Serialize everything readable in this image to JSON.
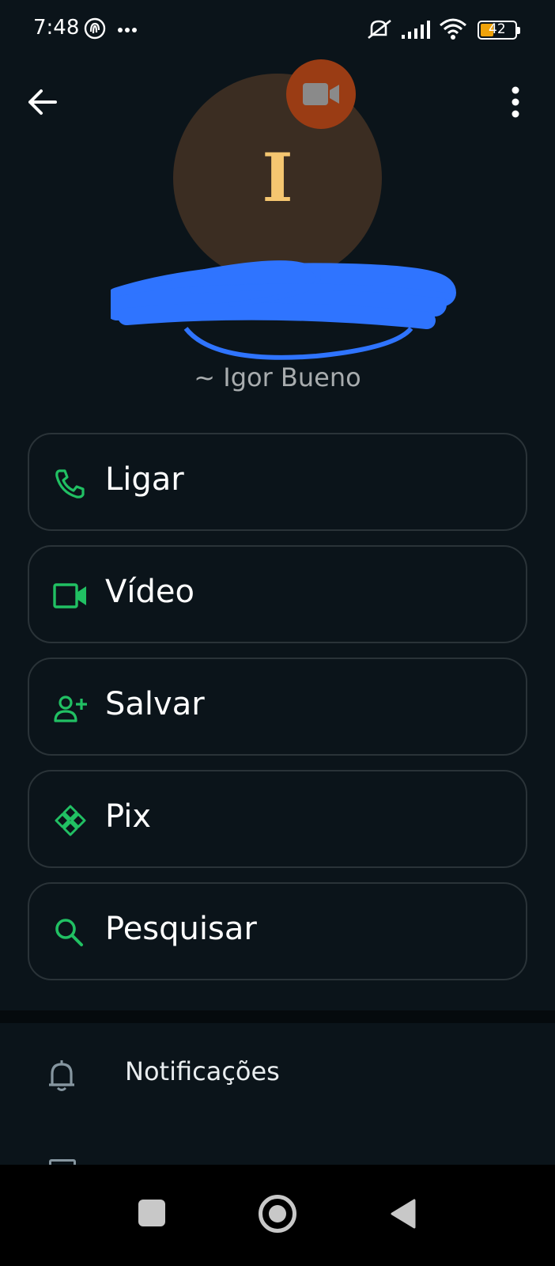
{
  "status_bar": {
    "time": "7:48",
    "battery_level": "42",
    "icons": [
      "fingerprint-icon",
      "more-dots-icon",
      "silent-icon",
      "signal-icon",
      "wifi-icon",
      "battery-icon"
    ]
  },
  "header": {
    "back_icon": "arrow-left-icon",
    "menu_icon": "more-vertical-icon"
  },
  "contact": {
    "avatar_letter": "I",
    "subtitle": "~ Igor Bueno",
    "avatar_bg": "#3b2d22",
    "avatar_fg": "#f5c670",
    "video_badge_bg": "#9a3c14",
    "name_redacted": true
  },
  "actions": [
    {
      "label": "Ligar",
      "icon": "phone-icon"
    },
    {
      "label": "Vídeo",
      "icon": "video-icon"
    },
    {
      "label": "Salvar",
      "icon": "add-person-icon"
    },
    {
      "label": "Pix",
      "icon": "pix-icon"
    },
    {
      "label": "Pesquisar",
      "icon": "search-icon"
    }
  ],
  "settings": {
    "notifications_label": "Notificações",
    "notifications_icon": "bell-icon"
  },
  "colors": {
    "background": "#0b141a",
    "accent_green": "#21c063",
    "button_border": "#2a3338",
    "scribble_blue": "#2f74ff"
  },
  "nav_bar": {
    "icons": [
      "recents-square-icon",
      "home-circle-icon",
      "back-triangle-icon"
    ]
  }
}
